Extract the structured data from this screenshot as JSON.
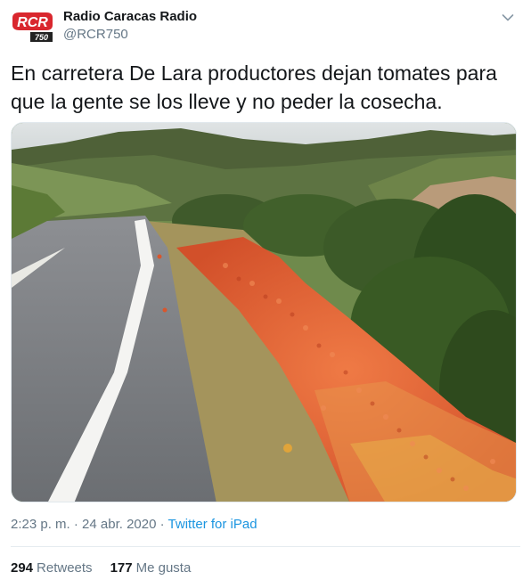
{
  "user": {
    "display_name": "Radio Caracas Radio",
    "handle": "@RCR750",
    "avatar_text": "RCR",
    "avatar_sub": "750"
  },
  "tweet": {
    "text": "En carretera De Lara productores dejan tomates para que la gente se los lleve y no peder la cosecha."
  },
  "media": {
    "icon": "photo-roadside-tomatoes"
  },
  "meta": {
    "time": "2:23 p. m.",
    "separator": " · ",
    "date": "24 abr. 2020",
    "source": "Twitter for iPad"
  },
  "stats": {
    "retweets_count": "294",
    "retweets_label": "Retweets",
    "likes_count": "177",
    "likes_label": "Me gusta"
  },
  "colors": {
    "link": "#1b95e0",
    "muted": "#657786",
    "text": "#14171a",
    "brand_red": "#d9272e"
  }
}
